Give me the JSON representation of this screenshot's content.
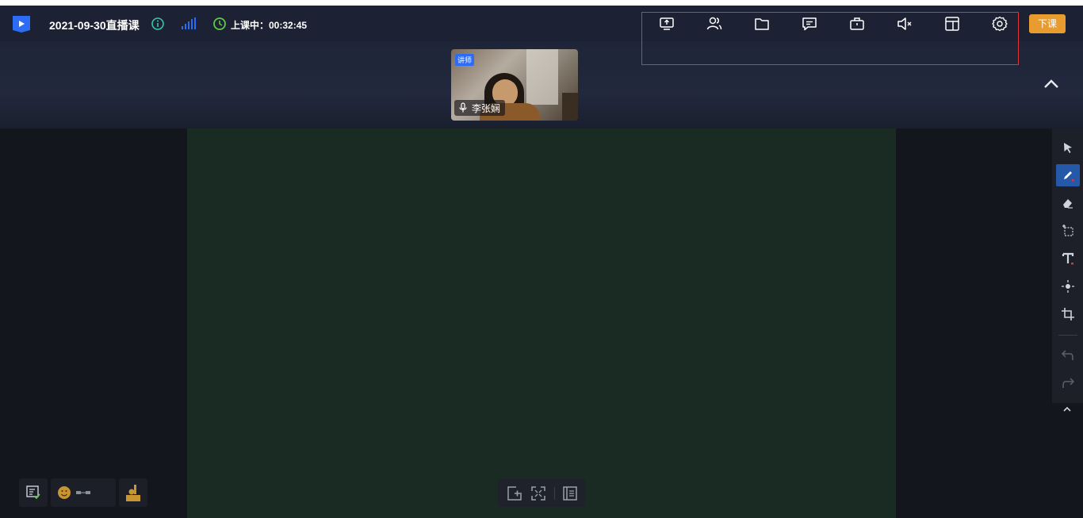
{
  "header": {
    "course_title": "2021-09-30直播课",
    "status_text": "上课中：00:32:45",
    "end_class_label": "下课",
    "toolbar_icons": [
      "screen-share-icon",
      "members-icon",
      "folder-icon",
      "chat-icon",
      "toolbox-icon",
      "speaker-mute-icon",
      "layout-icon",
      "settings-icon"
    ]
  },
  "video": {
    "role_badge": "讲师",
    "name": "李张娴"
  },
  "right_toolbar": {
    "tools": [
      "select-arrow-icon",
      "pen-icon",
      "eraser-icon",
      "selection-area-icon",
      "text-icon",
      "laser-pointer-icon",
      "crop-icon",
      "undo-icon",
      "redo-icon"
    ],
    "active_tool": "pen-icon"
  },
  "bottom_left": {
    "tools": [
      "danmaku-icon",
      "emoji-icon",
      "raise-hand-icon"
    ]
  },
  "bottom_center": {
    "tools": [
      "add-page-icon",
      "fullscreen-icon",
      "page-list-icon"
    ]
  },
  "colors": {
    "accent_blue": "#2d6cf5",
    "end_button": "#e89b2f",
    "highlight_border": "#e0323a",
    "whiteboard": "#1a2b24",
    "header_bg": "#1c2133",
    "status_green": "#5ec94a"
  }
}
